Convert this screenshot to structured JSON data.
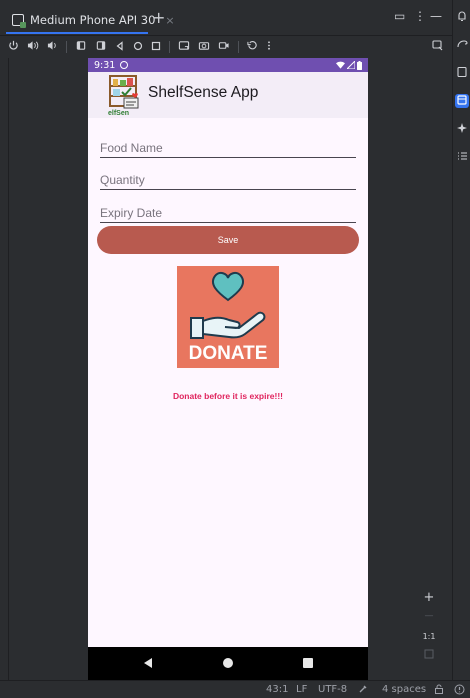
{
  "ide": {
    "tab_title": "Medium Phone API 30",
    "tab_close": "×",
    "tab_add": "+",
    "window_controls": [
      "▭",
      "⋮",
      "—"
    ],
    "device_toolbar_icons": [
      "power-icon",
      "volume-up-icon",
      "volume-down-icon",
      "rotate-left-icon",
      "rotate-right-icon",
      "back-icon",
      "home-icon",
      "overview-icon",
      "screenshot-icon",
      "camera-icon",
      "record-icon",
      "snapshot-icon",
      "more-icon"
    ],
    "zoom": {
      "plus": "+",
      "minus": "—",
      "ratio": "1:1"
    },
    "status": {
      "position": "43:1",
      "line_ending": "LF",
      "encoding": "UTF-8",
      "indent": "4 spaces"
    }
  },
  "phone": {
    "status_time": "9:31",
    "app_title": "ShelfSense App",
    "fields": {
      "food_name": {
        "placeholder": "Food Name",
        "value": ""
      },
      "quantity": {
        "placeholder": "Quantity",
        "value": ""
      },
      "expiry_date": {
        "placeholder": "Expiry Date",
        "value": ""
      }
    },
    "save_label": "Save",
    "donate_image_text": "DONATE",
    "donate_note": "Donate before it is expire!!!",
    "colors": {
      "status_bar": "#6f4fb0",
      "save_button": "#b85a4f",
      "donate_bg": "#e8765f",
      "note": "#e0245e"
    }
  }
}
